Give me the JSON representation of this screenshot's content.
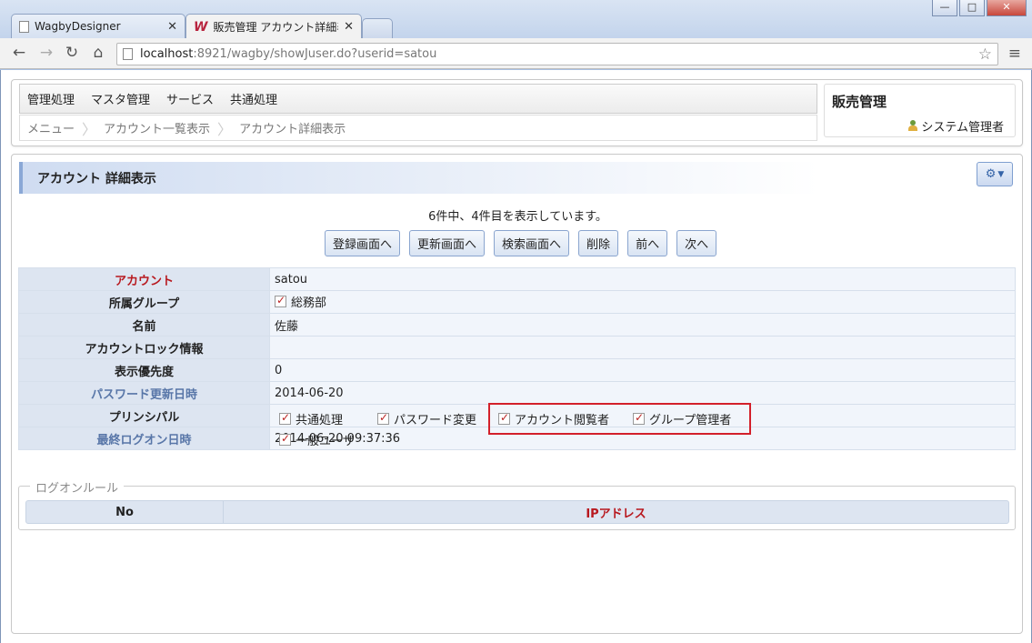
{
  "browser": {
    "tabs": [
      {
        "title": "WagbyDesigner",
        "active": false
      },
      {
        "title": "販売管理 アカウント詳細表示",
        "active": true
      }
    ],
    "url_host": "localhost",
    "url_rest": ":8921/wagby/showJuser.do?userid=satou",
    "window_buttons": {
      "minimize": "—",
      "maximize": "□",
      "close": "✕"
    }
  },
  "header": {
    "menu": [
      "管理処理",
      "マスタ管理",
      "サービス",
      "共通処理"
    ],
    "breadcrumb": [
      "メニュー",
      "アカウント一覧表示",
      "アカウント詳細表示"
    ],
    "app_title": "販売管理",
    "user_name": "システム管理者"
  },
  "main": {
    "heading": "アカウント 詳細表示",
    "count_text": "6件中、4件目を表示しています。",
    "buttons": [
      "登録画面へ",
      "更新画面へ",
      "検索画面へ",
      "削除",
      "前へ",
      "次へ"
    ],
    "fields": {
      "account": {
        "label": "アカウント",
        "value": "satou"
      },
      "group": {
        "label": "所属グループ",
        "value": "総務部"
      },
      "name": {
        "label": "名前",
        "value": "佐藤"
      },
      "lock": {
        "label": "アカウントロック情報",
        "value": ""
      },
      "priority": {
        "label": "表示優先度",
        "value": "0"
      },
      "pw_date": {
        "label": "パスワード更新日時",
        "value": "2014-06-20"
      },
      "principal": {
        "label": "プリンシパル",
        "items": [
          "共通処理",
          "パスワード変更",
          "アカウント閲覧者",
          "グループ管理者",
          "一般ユーザ"
        ]
      },
      "last_logon": {
        "label": "最終ログオン日時",
        "value": "2014-06-20 09:37:36"
      }
    },
    "logon_rule": {
      "legend": "ログオンルール",
      "columns": [
        "No",
        "IPアドレス"
      ]
    }
  },
  "colors": {
    "accent": "#8aa8d6",
    "required": "#b8181e",
    "highlight": "#d3202a"
  }
}
